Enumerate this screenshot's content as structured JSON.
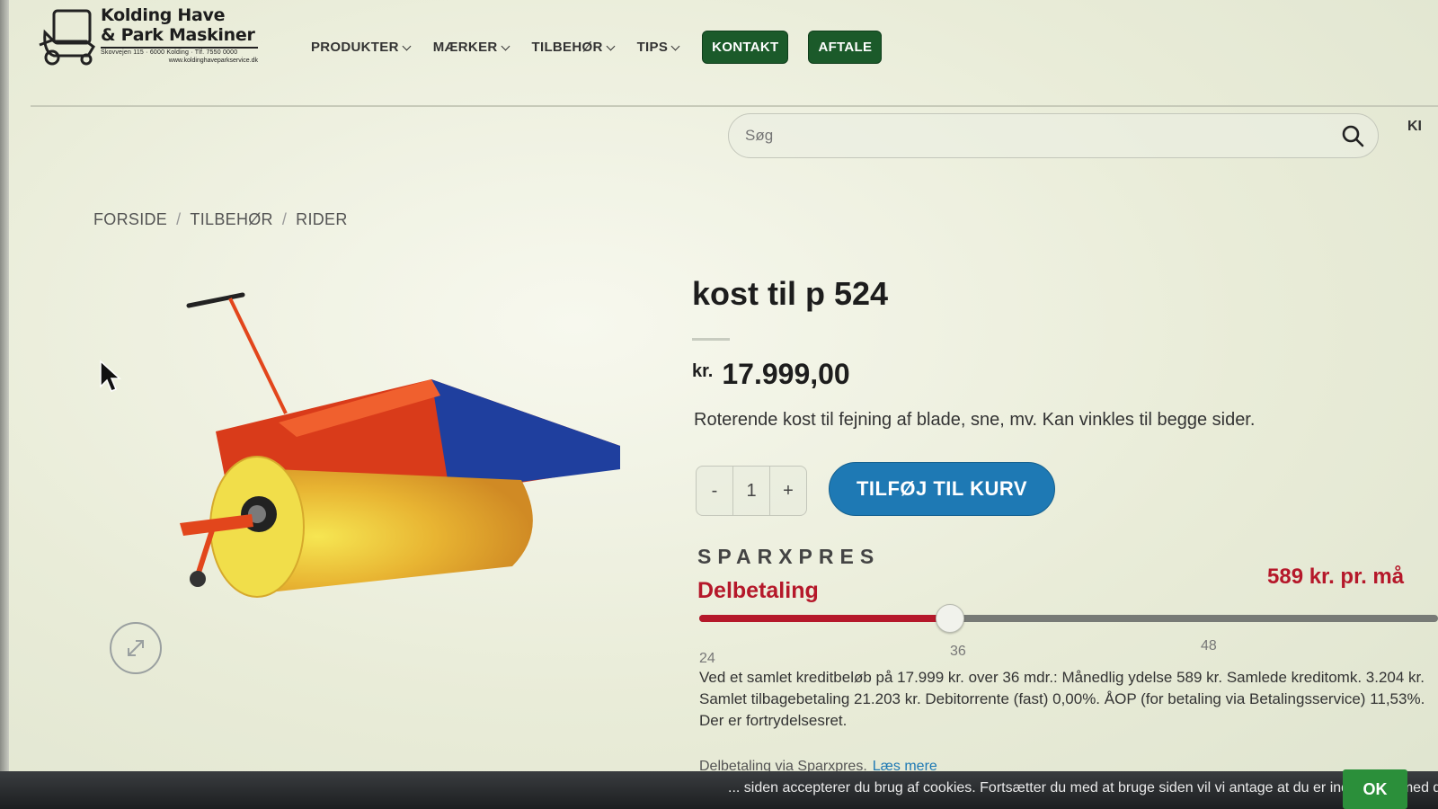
{
  "header": {
    "logo": {
      "line1": "Kolding Have",
      "line2": "& Park Maskiner",
      "small_text": "Skovvejen 115 · 6000 Kolding · Tlf. 7550 0000",
      "url": "www.koldinghaveparkservice.dk"
    },
    "nav": [
      {
        "label": "PRODUKTER",
        "has_dropdown": true
      },
      {
        "label": "MÆRKER",
        "has_dropdown": true
      },
      {
        "label": "TILBEHØR",
        "has_dropdown": true
      },
      {
        "label": "TIPS",
        "has_dropdown": true
      }
    ],
    "buttons": {
      "kontakt": "KONTAKT",
      "aftale": "AFTALE"
    },
    "search": {
      "placeholder": "Søg",
      "icon": "search-icon"
    },
    "cut_text": "KI"
  },
  "breadcrumb": [
    "FORSIDE",
    "TILBEHØR",
    "RIDER"
  ],
  "breadcrumb_separator": "/",
  "product": {
    "title": "kost til p 524",
    "currency": "kr.",
    "price": "17.999,00",
    "description": "Roterende kost til fejning af blade, sne, mv. Kan vinkles til begge sider.",
    "quantity": {
      "minus": "-",
      "value": "1",
      "plus": "+"
    },
    "add_to_cart": "TILFØJ TIL KURV"
  },
  "financing": {
    "brand": "SPARXPRES",
    "heading": "Delbetaling",
    "monthly": "589 kr. pr. må",
    "slider": {
      "min": 24,
      "max": 60,
      "value": 36,
      "ticks": [
        "24",
        "36",
        "48"
      ]
    },
    "terms": "Ved et samlet kreditbeløb på 17.999 kr. over 36 mdr.: Månedlig ydelse 589 kr. Samlede kreditomk. 3.204 kr. Samlet tilbagebetaling 21.203 kr. Debitorrente (fast) 0,00%. ÅOP (for betaling via Betalingsservice) 11,53%. Der er fortrydelsesret.",
    "more_prefix": "Delbetaling via Sparxpres.",
    "more_link": "Læs mere"
  },
  "cookie": {
    "text": "... siden accepterer du brug af cookies. Fortsætter du med at bruge siden vil vi antage at du er indforstået med det.",
    "ok": "OK"
  },
  "colors": {
    "nav_button": "#1b5a2a",
    "cart_button": "#1e79b4",
    "financing_red": "#b5182a",
    "cookie_ok": "#2b8f3a"
  }
}
